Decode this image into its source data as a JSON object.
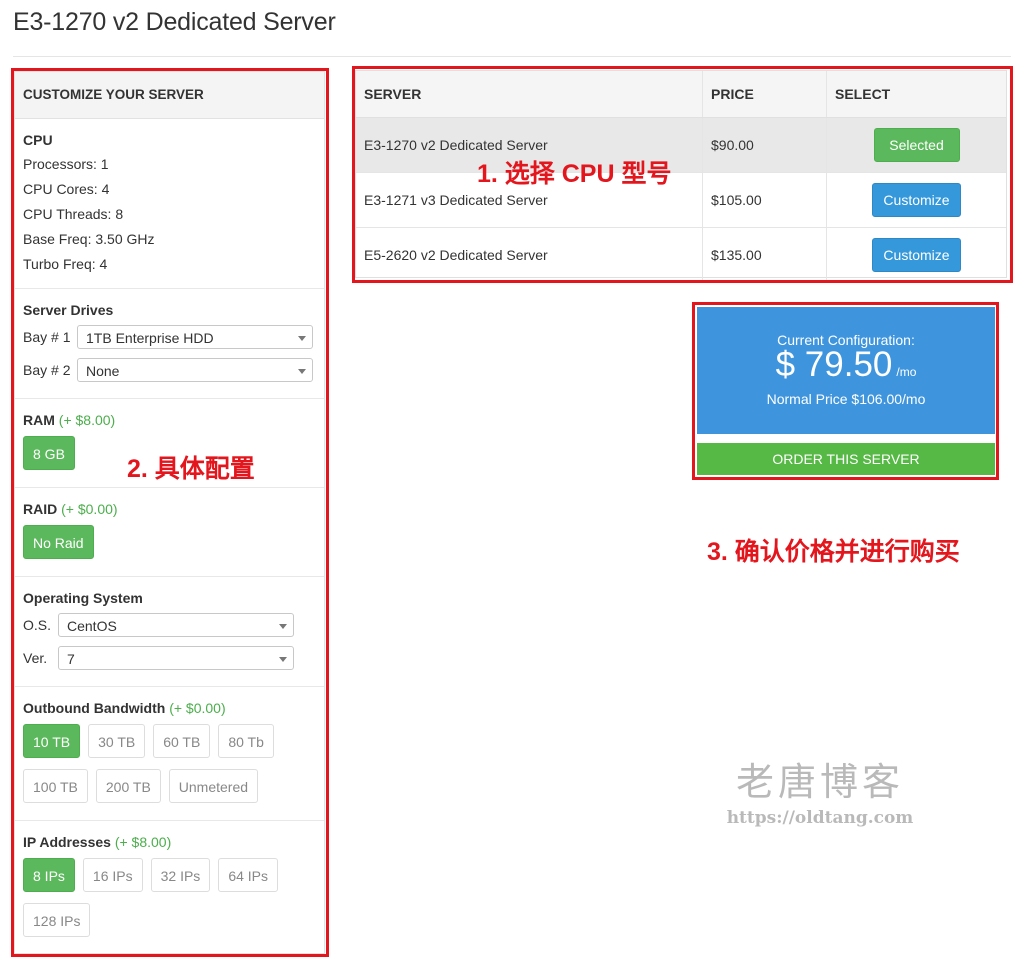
{
  "page": {
    "title": "E3-1270 v2 Dedicated Server"
  },
  "customize": {
    "header": "CUSTOMIZE YOUR SERVER",
    "cpu": {
      "title": "CPU",
      "lines": [
        "Processors: 1",
        "CPU Cores: 4",
        "CPU Threads: 8",
        "Base Freq: 3.50 GHz",
        "Turbo Freq: 4"
      ]
    },
    "drives": {
      "title": "Server Drives",
      "bays": [
        {
          "label": "Bay # 1",
          "value": "1TB Enterprise HDD"
        },
        {
          "label": "Bay # 2",
          "value": "None"
        }
      ]
    },
    "ram": {
      "title": "RAM",
      "extra": "(+ $8.00)",
      "options": [
        "8 GB"
      ]
    },
    "raid": {
      "title": "RAID",
      "extra": "(+ $0.00)",
      "options": [
        "No Raid"
      ]
    },
    "os": {
      "title": "Operating System",
      "os_label": "O.S.",
      "os_value": "CentOS",
      "ver_label": "Ver.",
      "ver_value": "7"
    },
    "bandwidth": {
      "title": "Outbound Bandwidth",
      "extra": "(+ $0.00)",
      "options": [
        "10 TB",
        "30 TB",
        "60 TB",
        "80 Tb",
        "100 TB",
        "200 TB",
        "Unmetered"
      ]
    },
    "ip": {
      "title": "IP Addresses",
      "extra": "(+ $8.00)",
      "options": [
        "8 IPs",
        "16 IPs",
        "32 IPs",
        "64 IPs",
        "128 IPs"
      ]
    }
  },
  "servers": {
    "headers": [
      "SERVER",
      "PRICE",
      "SELECT"
    ],
    "rows": [
      {
        "name": "E3-1270 v2 Dedicated Server",
        "price": "$90.00",
        "action": "Selected"
      },
      {
        "name": "E3-1271 v3 Dedicated Server",
        "price": "$105.00",
        "action": "Customize"
      },
      {
        "name": "E5-2620 v2 Dedicated Server",
        "price": "$135.00",
        "action": "Customize"
      }
    ]
  },
  "config": {
    "label": "Current Configuration:",
    "price": "$ 79.50",
    "per": "/mo",
    "normal": "Normal Price $106.00/mo",
    "order": "ORDER THIS SERVER"
  },
  "annotations": {
    "step1": "1. 选择 CPU 型号",
    "step2": "2. 具体配置",
    "step3": "3. 确认价格并进行购买"
  },
  "watermark": {
    "name": "老唐博客",
    "url": "https://oldtang.com"
  },
  "colors": {
    "green": "#5cb85c",
    "blue": "#3498db",
    "config_blue": "#3e95dd",
    "annotation_red": "#e4161d"
  }
}
